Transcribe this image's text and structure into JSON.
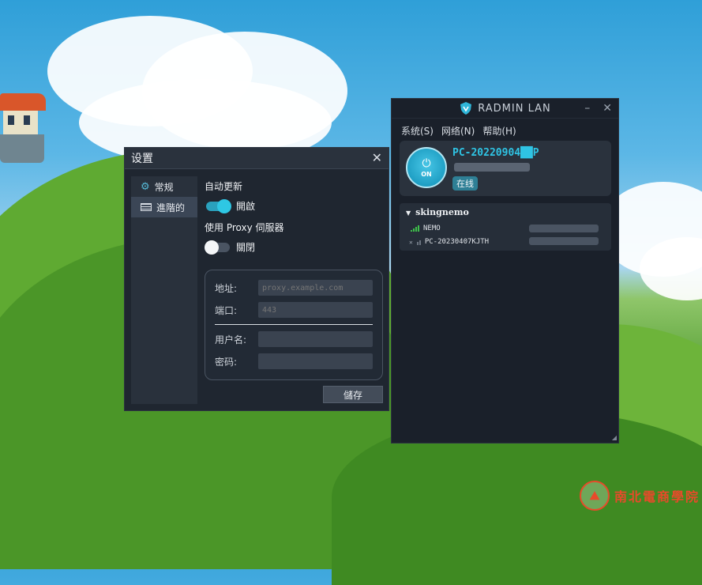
{
  "settings": {
    "title": "设置",
    "close": "✕",
    "sidebar": {
      "items": [
        {
          "label": "常规",
          "icon": "gear-icon"
        },
        {
          "label": "進階的",
          "icon": "list-icon"
        }
      ]
    },
    "auto_update": {
      "label": "自动更新",
      "state_label": "開啟",
      "enabled": true
    },
    "proxy": {
      "label": "使用 Proxy 伺服器",
      "state_label": "關閉",
      "enabled": false
    },
    "fields": {
      "address": {
        "label": "地址:",
        "placeholder": "proxy.example.com"
      },
      "port": {
        "label": "端口:",
        "placeholder": "443"
      },
      "username": {
        "label": "用户名:",
        "value": ""
      },
      "password": {
        "label": "密码:",
        "value": ""
      }
    },
    "save_label": "儲存"
  },
  "radmin": {
    "title": "RADMIN LAN",
    "minimize": "–",
    "close": "✕",
    "menu": [
      "系统(S)",
      "网络(N)",
      "帮助(H)"
    ],
    "power": {
      "symbol": "⏻",
      "label": "ON"
    },
    "pc_name": "PC-20220904██P",
    "status": "在线",
    "network": {
      "name": "skingnemo",
      "peers": [
        {
          "name": "NEMO",
          "online": true
        },
        {
          "name": "PC-20230407KJTH",
          "online": false
        }
      ]
    }
  },
  "watermark": {
    "text": "南北電商學院"
  },
  "colors": {
    "accent": "#2fc4e4",
    "toggle_on": "#2aa1bd",
    "dialog_bg": "#1f2630",
    "watermark": "#e84a2a"
  }
}
